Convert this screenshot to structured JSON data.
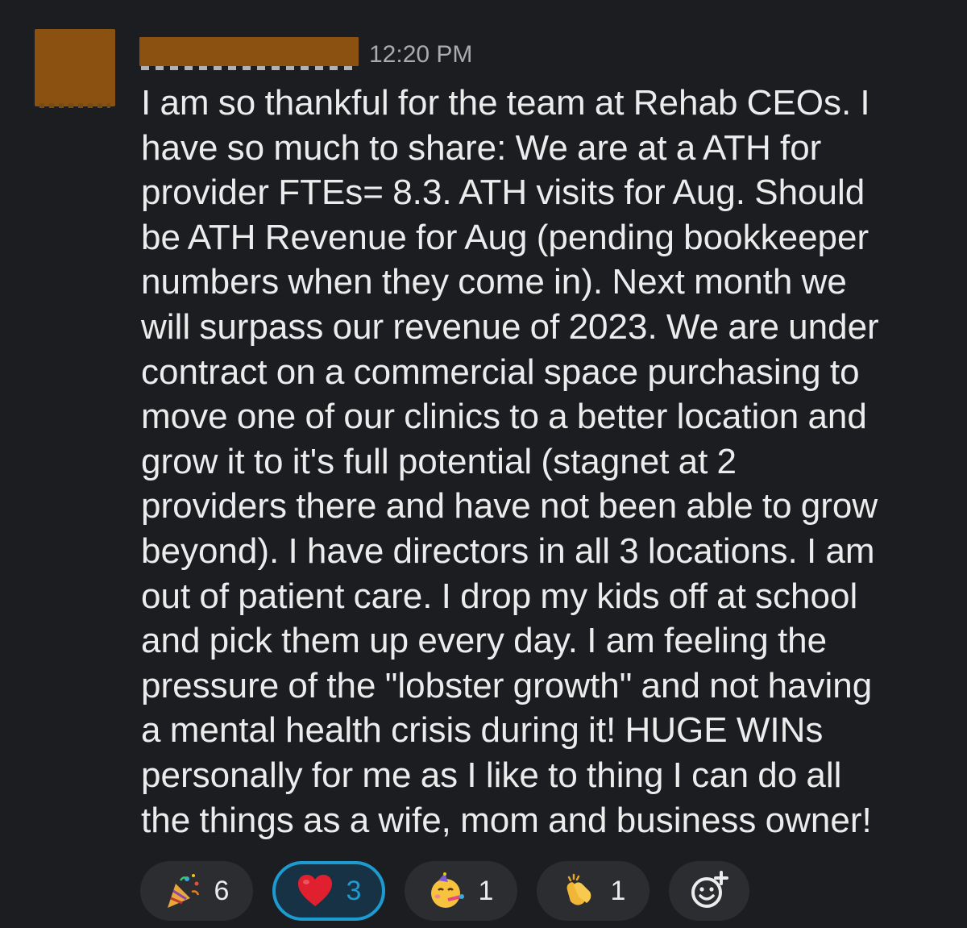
{
  "message": {
    "timestamp": "12:20 PM",
    "lines": [
      "I am so thankful for the team at Rehab CEOs. I",
      "have so much to share: We are at a ATH for",
      "provider FTEs= 8.3. ATH visits for Aug. Should",
      "be ATH Revenue for Aug (pending bookkeeper",
      "numbers when they come in). Next month we",
      "will surpass our revenue of 2023. We are under",
      "contract on a commercial space purchasing to",
      "move one of our clinics to a better location and",
      "grow it to it's full potential (stagnet at 2",
      "providers there and have not been able to grow",
      "beyond). I have directors in all 3 locations. I am",
      "out of patient care. I drop my kids off at school",
      "and pick them up every day. I am feeling the",
      "pressure of the \"lobster growth\" and not having",
      "a mental health crisis during it! HUGE WINs",
      "personally for me as I like to thing I can do all",
      "the things as a wife, mom and business owner!"
    ]
  },
  "reactions": [
    {
      "icon": "party-popper-icon",
      "count": "6",
      "selected": false
    },
    {
      "icon": "red-heart-icon",
      "count": "3",
      "selected": true
    },
    {
      "icon": "partying-face-icon",
      "count": "1",
      "selected": false
    },
    {
      "icon": "clapping-hands-icon",
      "count": "1",
      "selected": false
    }
  ],
  "add_reaction": {
    "icon": "add-reaction-icon"
  },
  "colors": {
    "background": "#1b1d21",
    "text": "#ececec",
    "timestamp": "#a9abae",
    "redaction": "#8a5110",
    "reaction_bg": "#2b2d31",
    "selected_border": "#1d9bd1"
  }
}
